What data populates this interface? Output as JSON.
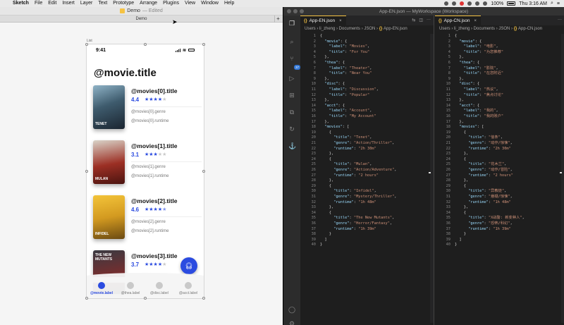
{
  "menubar": {
    "apple": "",
    "app": "Sketch",
    "items": [
      "File",
      "Edit",
      "Insert",
      "Layer",
      "Text",
      "Prototype",
      "Arrange",
      "Plugins",
      "View",
      "Window",
      "Help"
    ],
    "battery": "100%",
    "clock": "Thu 3:16 AM"
  },
  "sketch": {
    "doc_title": "Demo",
    "doc_status": "— Edited",
    "tab": "Demo",
    "artboard_label": "List",
    "status_time": "9:41",
    "page_title": "@movie.title",
    "movies": [
      {
        "title": "@movies[0].title",
        "rating": "4.4",
        "stars": 4,
        "genre": "@movies[0].genre",
        "runtime": "@movies[0].runtime",
        "poster_text": "TENET"
      },
      {
        "title": "@movies[1].title",
        "rating": "3.1",
        "stars": 3,
        "genre": "@movies[1].genre",
        "runtime": "@movies[1].runtime",
        "poster_text": "MULAN"
      },
      {
        "title": "@movies[2].title",
        "rating": "4.6",
        "stars": 4.5,
        "genre": "@movies[2].genre",
        "runtime": "@movies[2].runtime",
        "poster_text": "INFIDEL"
      },
      {
        "title": "@movies[3].title",
        "rating": "3.7",
        "stars": 4,
        "genre": "",
        "runtime": "",
        "poster_text": "THE NEW MUTANTS"
      }
    ],
    "tabs": [
      "@movie.label",
      "@thea.label",
      "@disc.label",
      "@acct.label"
    ]
  },
  "vscode": {
    "title": "App-EN.json — MyWorkspace (Workspace)",
    "activity_badge": "37",
    "left": {
      "tab": "App-EN.json",
      "crumbs": "Users › li_zheng › Documents › JSON › ",
      "crumb_file": "App-EN.json",
      "lines": [
        "{",
        "  \"movie\": {",
        "    \"label\": \"Movies\",",
        "    \"title\": \"For You\"",
        "  },",
        "  \"thea\": {",
        "    \"label\": \"Theater\",",
        "    \"title\": \"Near You\"",
        "  },",
        "  \"disc\": {",
        "    \"label\": \"Discussion\",",
        "    \"title\": \"Popular\"",
        "  },",
        "  \"acct\": {",
        "    \"label\": \"Account\",",
        "    \"title\": \"My Account\"",
        "  },",
        "  \"movies\": [",
        "    {",
        "      \"title\": \"Tenet\",",
        "      \"genre\": \"Action/Thriller\",",
        "      \"runtime\": \"2h 30m\"",
        "    },",
        "    {",
        "      \"title\": \"Mulan\",",
        "      \"genre\": \"Action/Adventure\",",
        "      \"runtime\": \"2 hours\"",
        "    },",
        "    {",
        "      \"title\": \"Infidel\",",
        "      \"genre\": \"Mystery/Thriller\",",
        "      \"runtime\": \"1h 48m\"",
        "    },",
        "    {",
        "      \"title\": \"The New Mutants\",",
        "      \"genre\": \"Horror/Fantasy\",",
        "      \"runtime\": \"1h 39m\"",
        "    }",
        "  ]",
        "}"
      ]
    },
    "right": {
      "tab": "App-CN.json",
      "crumbs": "Users › li_zheng › Documents › JSON › ",
      "crumb_file": "App-CN.json",
      "lines": [
        "{",
        "  \"movie\": {",
        "    \"label\": \"电影\",",
        "    \"title\": \"为您推荐\"",
        "  },",
        "  \"thea\": {",
        "    \"label\": \"影院\",",
        "    \"title\": \"在您附近\"",
        "  },",
        "  \"disc\": {",
        "    \"label\": \"热议\",",
        "    \"title\": \"焦点讨论\"",
        "  },",
        "  \"acct\": {",
        "    \"label\": \"我的\",",
        "    \"title\": \"我的账户\"",
        "  },",
        "  \"movies\": [",
        "    {",
        "      \"title\": \"信条\",",
        "      \"genre\": \"动作/惊悚\",",
        "      \"runtime\": \"2h 30m\"",
        "    },",
        "    {",
        "      \"title\": \"花木兰\",",
        "      \"genre\": \"动作/冒险\",",
        "      \"runtime\": \"2 hours\"",
        "    },",
        "    {",
        "      \"title\": \"异教徒\",",
        "      \"genre\": \"悬疑/惊悚\",",
        "      \"runtime\": \"1h 48m\"",
        "    },",
        "    {",
        "      \"title\": \"X战警: 新变种人\",",
        "      \"genre\": \"恐怖/科幻\",",
        "      \"runtime\": \"1h 39m\"",
        "    }",
        "  ]",
        "}"
      ]
    }
  },
  "colors": {
    "accent": "#2b4be0",
    "json_key": "#9cdcfe",
    "json_string": "#ce9178",
    "json_icon": "#f6c343"
  }
}
